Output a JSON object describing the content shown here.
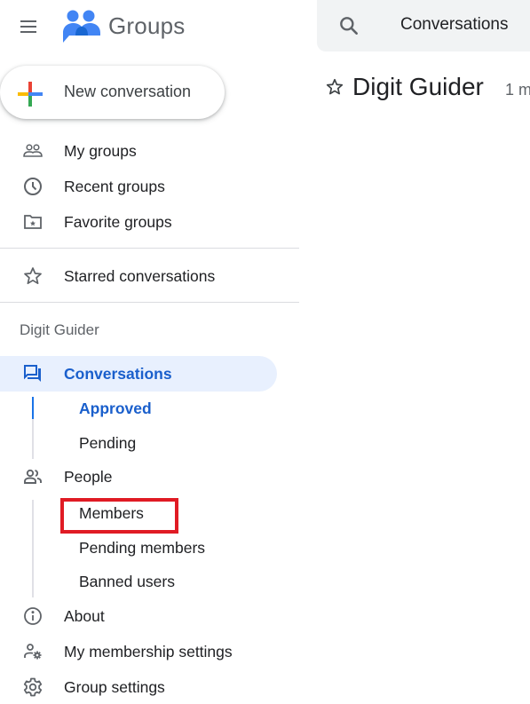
{
  "header": {
    "app_title": "Groups",
    "search_text": "Conversations"
  },
  "new_conversation": {
    "label": "New conversation"
  },
  "nav": {
    "top_items": [
      {
        "label": "My groups",
        "icon": "people-outline-icon"
      },
      {
        "label": "Recent groups",
        "icon": "clock-icon"
      },
      {
        "label": "Favorite groups",
        "icon": "folder-star-icon"
      }
    ],
    "starred": {
      "label": "Starred conversations",
      "icon": "star-outline-icon"
    }
  },
  "group": {
    "name": "Digit Guider",
    "conversations": {
      "label": "Conversations",
      "icon": "forum-icon",
      "active": true,
      "sub_items": [
        {
          "label": "Approved",
          "active": true
        },
        {
          "label": "Pending",
          "active": false
        }
      ]
    },
    "people": {
      "label": "People",
      "icon": "people-icon",
      "sub_items": [
        {
          "label": "Members",
          "highlighted": true
        },
        {
          "label": "Pending members"
        },
        {
          "label": "Banned users"
        }
      ]
    },
    "about": {
      "label": "About",
      "icon": "info-icon"
    },
    "membership_settings": {
      "label": "My membership settings",
      "icon": "person-settings-icon"
    },
    "group_settings": {
      "label": "Group settings",
      "icon": "gear-icon"
    }
  },
  "main": {
    "title": "Digit Guider",
    "meta": "1 m"
  },
  "colors": {
    "accent": "#1a73e8",
    "active_bg": "#e8f0fe",
    "highlight_box": "#e01b24",
    "search_bg": "#f1f3f4"
  }
}
